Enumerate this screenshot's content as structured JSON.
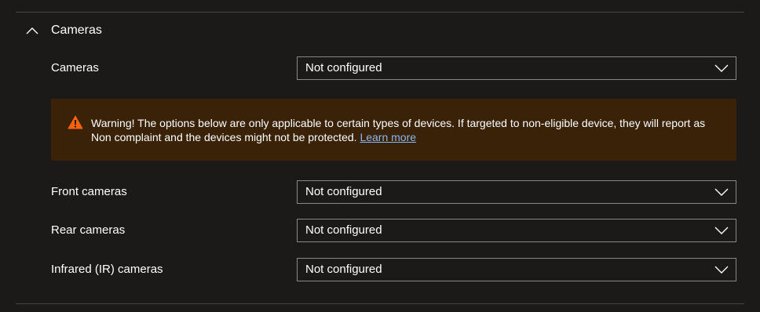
{
  "section": {
    "title": "Cameras",
    "expanded": true,
    "icon": "chevron-up-icon"
  },
  "settings": {
    "cameras": {
      "label": "Cameras",
      "value": "Not configured"
    },
    "front_cameras": {
      "label": "Front cameras",
      "value": "Not configured"
    },
    "rear_cameras": {
      "label": "Rear cameras",
      "value": "Not configured"
    },
    "infrared_cameras": {
      "label": "Infrared (IR) cameras",
      "value": "Not configured"
    }
  },
  "warning": {
    "icon": "warning-icon",
    "text": "Warning! The options below are only applicable to certain types of devices. If targeted to non-eligible device, they will report as Non complaint and the devices might not be protected.",
    "link_label": "Learn more"
  },
  "colors": {
    "background": "#1b1a19",
    "warning_background": "#3a2208",
    "warning_icon": "#f7630c",
    "link": "#8ab8ea",
    "dropdown_border": "#8a8886",
    "divider": "#484644"
  }
}
